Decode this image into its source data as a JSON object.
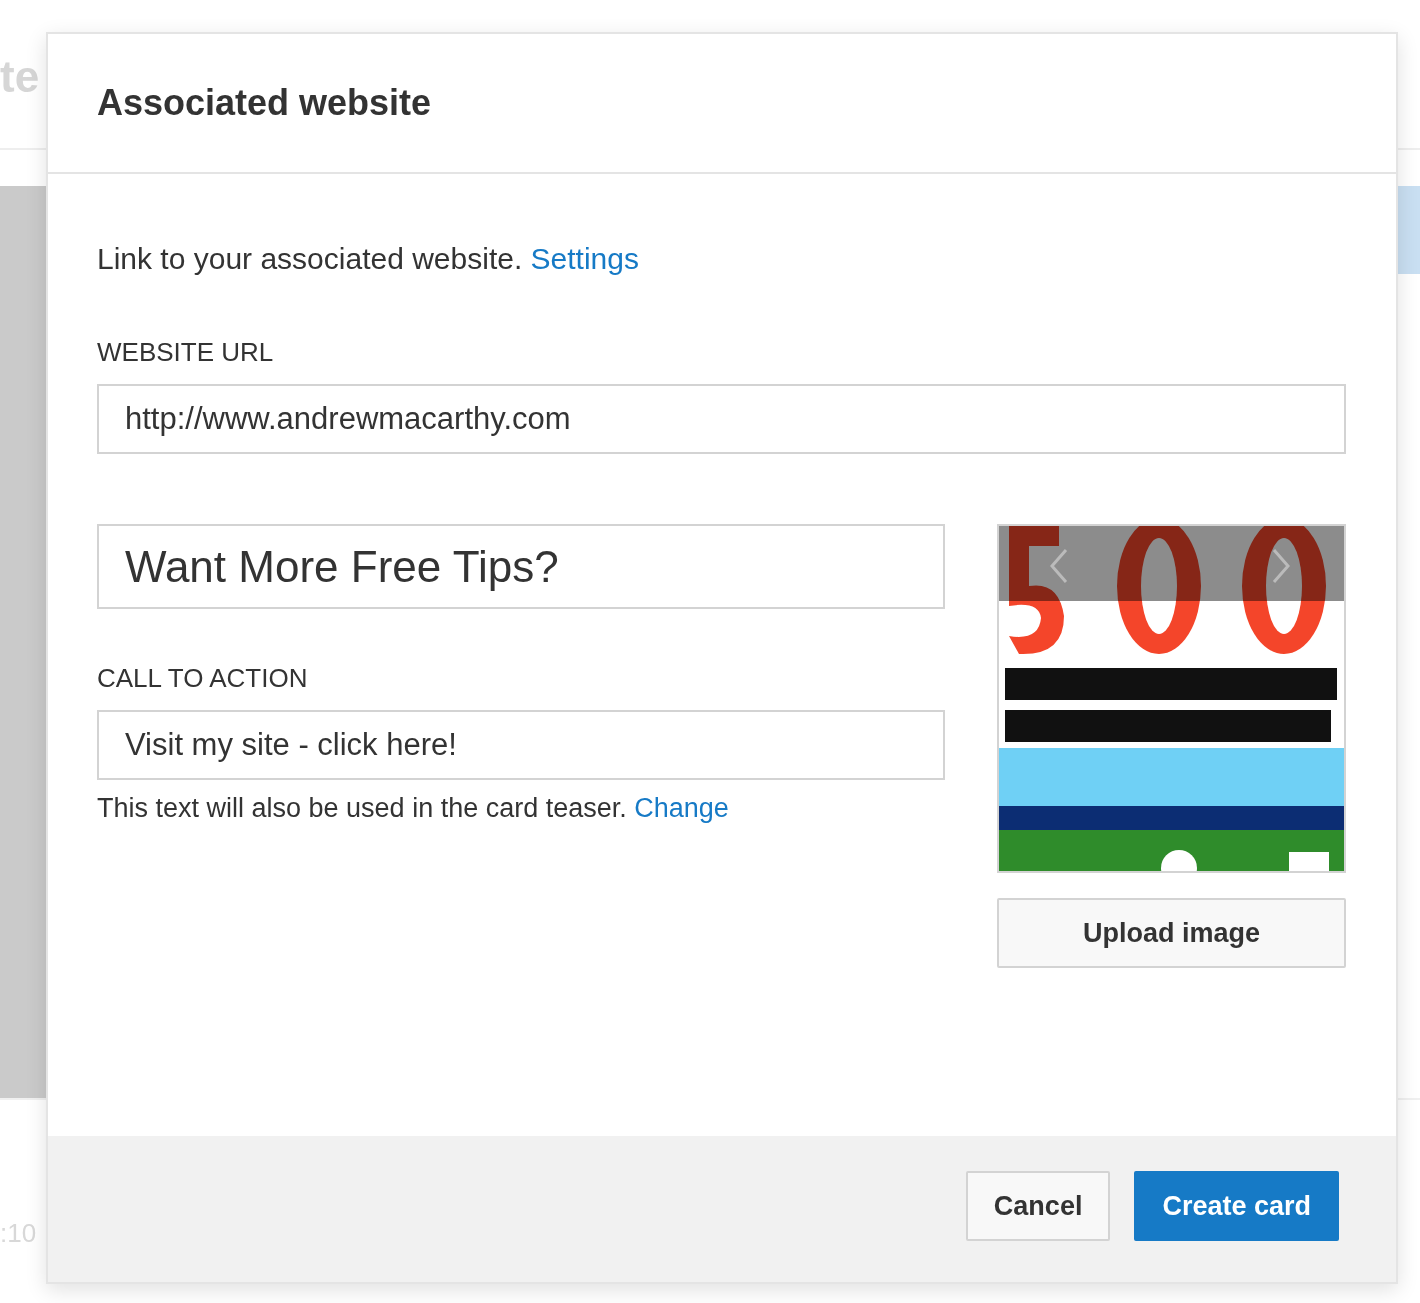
{
  "background": {
    "heading_fragment": "te",
    "time_fragment": ":10"
  },
  "dialog": {
    "title": "Associated website",
    "intro": "Link to your associated website.",
    "intro_link": "Settings",
    "url_label": "WEBSITE URL",
    "url_value": "http://www.andrewmacarthy.com",
    "headline_value": "Want More Free Tips?",
    "cta_label": "CALL TO ACTION",
    "cta_value": "Visit my site - click here!",
    "hint": "This text will also be used in the card teaser.",
    "hint_link": "Change",
    "upload_button": "Upload image",
    "buttons": [
      {
        "label": "Cancel",
        "kind": "secondary"
      },
      {
        "label": "Create card",
        "kind": "primary"
      }
    ]
  }
}
